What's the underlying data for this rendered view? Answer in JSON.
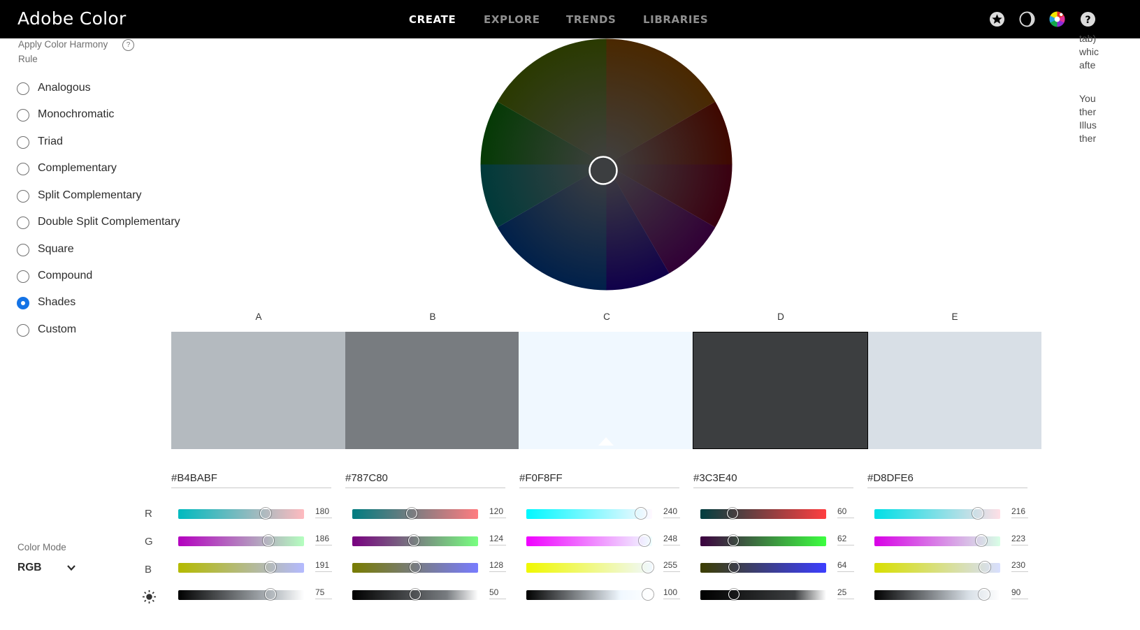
{
  "app": {
    "title": "Adobe Color"
  },
  "nav": [
    {
      "label": "CREATE",
      "active": true
    },
    {
      "label": "EXPLORE",
      "active": false
    },
    {
      "label": "TRENDS",
      "active": false
    },
    {
      "label": "LIBRARIES",
      "active": false
    }
  ],
  "toolbar_icons": [
    "star-icon",
    "contrast-icon",
    "color-wheel-icon",
    "help-icon"
  ],
  "harmony": {
    "title": "Apply Color Harmony Rule",
    "help": "?",
    "rules": [
      {
        "label": "Analogous",
        "checked": false
      },
      {
        "label": "Monochromatic",
        "checked": false
      },
      {
        "label": "Triad",
        "checked": false
      },
      {
        "label": "Complementary",
        "checked": false
      },
      {
        "label": "Split Complementary",
        "checked": false
      },
      {
        "label": "Double Split Complementary",
        "checked": false
      },
      {
        "label": "Square",
        "checked": false
      },
      {
        "label": "Compound",
        "checked": false
      },
      {
        "label": "Shades",
        "checked": true
      },
      {
        "label": "Custom",
        "checked": false
      }
    ]
  },
  "right_panel_text": [
    "tab)",
    "whic",
    "afte",
    "You",
    "ther",
    "Illus",
    "ther"
  ],
  "columns": [
    {
      "letter": "A",
      "hex": "#B4BABF",
      "r": "180",
      "g": "186",
      "b": "191",
      "brightness": "75"
    },
    {
      "letter": "B",
      "hex": "#787C80",
      "r": "120",
      "g": "124",
      "b": "128",
      "brightness": "50"
    },
    {
      "letter": "C",
      "hex": "#F0F8FF",
      "r": "240",
      "g": "248",
      "b": "255",
      "brightness": "100"
    },
    {
      "letter": "D",
      "hex": "#3C3E40",
      "r": "60",
      "g": "62",
      "b": "64",
      "brightness": "25"
    },
    {
      "letter": "E",
      "hex": "#D8DFE6",
      "r": "216",
      "g": "223",
      "b": "230",
      "brightness": "90"
    }
  ],
  "channels": [
    "R",
    "G",
    "B"
  ],
  "color_mode": {
    "label": "Color Mode",
    "value": "RGB"
  },
  "colors": {
    "accent": "#1473e6",
    "topbar": "#000000"
  }
}
